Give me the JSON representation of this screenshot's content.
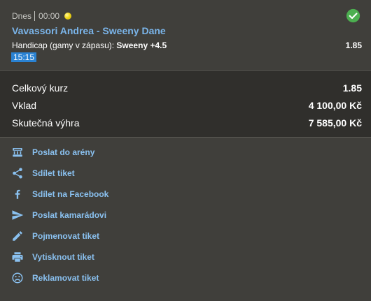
{
  "event": {
    "day": "Dnes",
    "time": "00:00",
    "sport_icon": "tennis-ball-icon",
    "status_icon": "check-circle-icon",
    "match": "Vavassori Andrea - Sweeny Dane",
    "market": "Handicap (gamy v zápasu):",
    "selection": "Sweeny +4.5",
    "odds": "1.85",
    "time_badge": "15:15"
  },
  "summary": {
    "total_odds_label": "Celkový kurz",
    "total_odds_value": "1.85",
    "stake_label": "Vklad",
    "stake_value": "4 100,00 Kč",
    "win_label": "Skutečná výhra",
    "win_value": "7 585,00 Kč"
  },
  "actions": [
    {
      "label": "Poslat do arény",
      "icon": "arena-icon"
    },
    {
      "label": "Sdílet tiket",
      "icon": "share-icon"
    },
    {
      "label": "Sdílet na Facebook",
      "icon": "facebook-icon"
    },
    {
      "label": "Poslat kamarádovi",
      "icon": "send-icon"
    },
    {
      "label": "Pojmenovat tiket",
      "icon": "pencil-icon"
    },
    {
      "label": "Vytisknout tiket",
      "icon": "printer-icon"
    },
    {
      "label": "Reklamovat tiket",
      "icon": "sad-face-icon"
    }
  ],
  "colors": {
    "background": "#403f3b",
    "summary_background": "#302f2c",
    "link": "#8ac1f0",
    "match_name": "#7ab4e9",
    "badge": "#2a82d2",
    "success": "#4caf50"
  }
}
